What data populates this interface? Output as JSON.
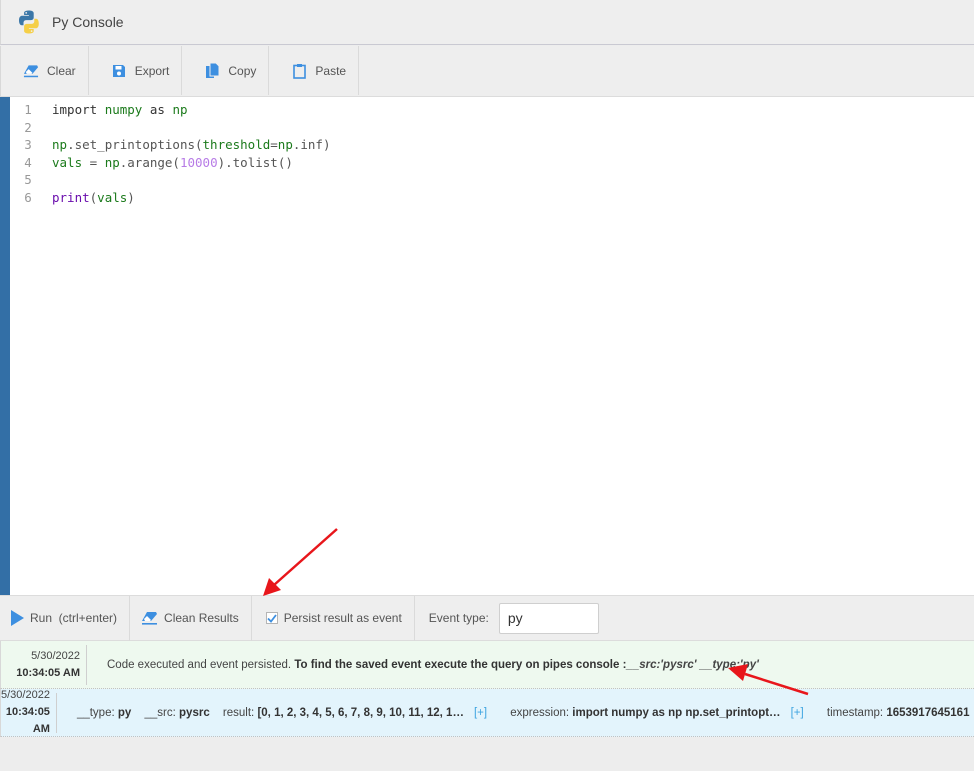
{
  "app": {
    "title": "Py Console",
    "logo_icon": "python-logo-icon"
  },
  "toolbar": {
    "buttons": [
      {
        "label": "Clear",
        "icon": "eraser-icon"
      },
      {
        "label": "Export",
        "icon": "save-icon"
      },
      {
        "label": "Copy",
        "icon": "copy-icon"
      },
      {
        "label": "Paste",
        "icon": "clipboard-icon"
      }
    ]
  },
  "editor": {
    "lines": [
      {
        "n": "1",
        "text": "import numpy as np"
      },
      {
        "n": "2",
        "text": ""
      },
      {
        "n": "3",
        "text": "np.set_printoptions(threshold=np.inf)"
      },
      {
        "n": "4",
        "text": "vals = np.arange(10000).tolist()"
      },
      {
        "n": "5",
        "text": ""
      },
      {
        "n": "6",
        "text": "print(vals)"
      }
    ]
  },
  "runbar": {
    "run_label": "Run  (ctrl+enter)",
    "clean_label": "Clean Results",
    "persist_label": "Persist result as event",
    "persist_checked": true,
    "event_type_label": "Event type:",
    "event_type_value": "py"
  },
  "results": [
    {
      "date": "5/30/2022",
      "time": "10:34:05 AM",
      "msg_plain": "Code executed and event persisted. ",
      "msg_bold": "To find the saved event execute the query on pipes console :",
      "msg_query": "__src:'pysrc' __type:'py'"
    },
    {
      "date": "5/30/2022",
      "time": "10:34:05 AM",
      "type_key": "__type:",
      "type_val": "py",
      "src_key": "__src:",
      "src_val": "pysrc",
      "result_key": "result:",
      "result_val": "[0, 1, 2, 3, 4, 5, 6, 7, 8, 9, 10, 11, 12, 1…",
      "expand_label": "[+]",
      "expr_key": "expression:",
      "expr_val": "import numpy as np np.set_printopt…",
      "ts_key": "timestamp:",
      "ts_val": "1653917645161"
    }
  ],
  "colors": {
    "accent_blue": "#3da4e0",
    "gutter": "#336fa6",
    "annotation_arrow": "#e8161b"
  }
}
